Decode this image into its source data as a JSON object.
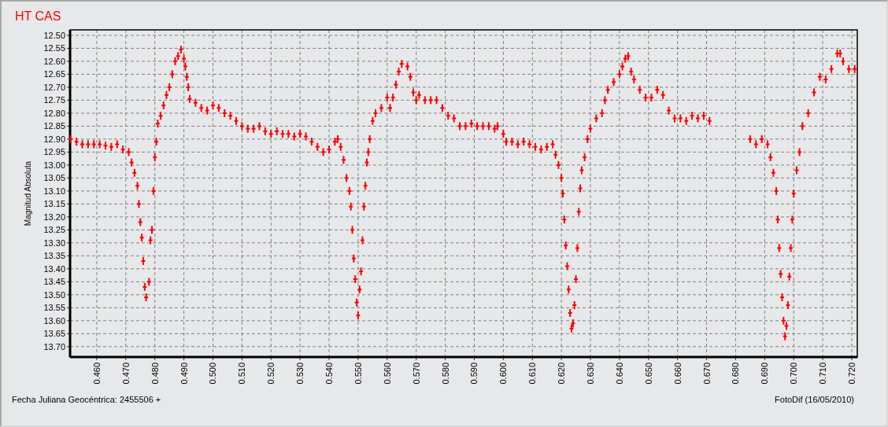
{
  "title": "HT CAS",
  "chart": {
    "chart_data": {
      "type": "scatter",
      "grid": true,
      "ylabel": "Magnitud Absoluta",
      "xlabel": "Fecha Juliana Geocéntrica: 2455506 +",
      "xlim": [
        0.4508,
        0.7219
      ],
      "ylim": [
        13.74,
        12.479
      ],
      "xticks": [
        {
          "value": 0.46,
          "label": "0.460"
        },
        {
          "value": 0.47,
          "label": "0.470"
        },
        {
          "value": 0.48,
          "label": "0.480"
        },
        {
          "value": 0.49,
          "label": "0.490"
        },
        {
          "value": 0.5,
          "label": "0.500"
        },
        {
          "value": 0.51,
          "label": "0.510"
        },
        {
          "value": 0.52,
          "label": "0.520"
        },
        {
          "value": 0.53,
          "label": "0.530"
        },
        {
          "value": 0.54,
          "label": "0.540"
        },
        {
          "value": 0.55,
          "label": "0.550"
        },
        {
          "value": 0.56,
          "label": "0.560"
        },
        {
          "value": 0.57,
          "label": "0.570"
        },
        {
          "value": 0.58,
          "label": "0.580"
        },
        {
          "value": 0.59,
          "label": "0.590"
        },
        {
          "value": 0.6,
          "label": "0.600"
        },
        {
          "value": 0.61,
          "label": "0.610"
        },
        {
          "value": 0.62,
          "label": "0.620"
        },
        {
          "value": 0.63,
          "label": "0.630"
        },
        {
          "value": 0.64,
          "label": "0.640"
        },
        {
          "value": 0.65,
          "label": "0.650"
        },
        {
          "value": 0.66,
          "label": "0.660"
        },
        {
          "value": 0.67,
          "label": "0.670"
        },
        {
          "value": 0.68,
          "label": "0.680"
        },
        {
          "value": 0.69,
          "label": "0.690"
        },
        {
          "value": 0.7,
          "label": "0.700"
        },
        {
          "value": 0.71,
          "label": "0.710"
        },
        {
          "value": 0.72,
          "label": "0.720"
        }
      ],
      "yticks": [
        {
          "value": 12.5,
          "label": "12.50"
        },
        {
          "value": 12.55,
          "label": "12.55"
        },
        {
          "value": 12.6,
          "label": "12.60"
        },
        {
          "value": 12.65,
          "label": "12.65"
        },
        {
          "value": 12.7,
          "label": "12.70"
        },
        {
          "value": 12.75,
          "label": "12.75"
        },
        {
          "value": 12.8,
          "label": "12.80"
        },
        {
          "value": 12.85,
          "label": "12.85"
        },
        {
          "value": 12.9,
          "label": "12.90"
        },
        {
          "value": 12.95,
          "label": "12.95"
        },
        {
          "value": 13.0,
          "label": "13.00"
        },
        {
          "value": 13.05,
          "label": "13.05"
        },
        {
          "value": 13.1,
          "label": "13.10"
        },
        {
          "value": 13.15,
          "label": "13.15"
        },
        {
          "value": 13.2,
          "label": "13.20"
        },
        {
          "value": 13.25,
          "label": "13.25"
        },
        {
          "value": 13.3,
          "label": "13.30"
        },
        {
          "value": 13.35,
          "label": "13.35"
        },
        {
          "value": 13.4,
          "label": "13.40"
        },
        {
          "value": 13.45,
          "label": "13.45"
        },
        {
          "value": 13.5,
          "label": "13.50"
        },
        {
          "value": 13.55,
          "label": "13.55"
        },
        {
          "value": 13.6,
          "label": "13.60"
        },
        {
          "value": 13.65,
          "label": "13.65"
        },
        {
          "value": 13.7,
          "label": "13.70"
        }
      ],
      "x": [
        0.451,
        0.453,
        0.455,
        0.457,
        0.459,
        0.461,
        0.463,
        0.465,
        0.467,
        0.469,
        0.471,
        0.472,
        0.473,
        0.474,
        0.4745,
        0.475,
        0.4755,
        0.476,
        0.4765,
        0.477,
        0.478,
        0.4785,
        0.479,
        0.4795,
        0.48,
        0.4805,
        0.481,
        0.482,
        0.483,
        0.484,
        0.485,
        0.486,
        0.487,
        0.488,
        0.489,
        0.49,
        0.4905,
        0.491,
        0.4915,
        0.492,
        0.494,
        0.496,
        0.498,
        0.5,
        0.502,
        0.504,
        0.506,
        0.508,
        0.51,
        0.512,
        0.514,
        0.516,
        0.518,
        0.52,
        0.522,
        0.524,
        0.526,
        0.528,
        0.53,
        0.532,
        0.534,
        0.536,
        0.538,
        0.54,
        0.542,
        0.543,
        0.544,
        0.545,
        0.546,
        0.547,
        0.5475,
        0.548,
        0.5485,
        0.549,
        0.5495,
        0.55,
        0.5505,
        0.551,
        0.5515,
        0.552,
        0.5525,
        0.553,
        0.5535,
        0.554,
        0.555,
        0.556,
        0.558,
        0.56,
        0.561,
        0.562,
        0.563,
        0.564,
        0.565,
        0.567,
        0.568,
        0.569,
        0.57,
        0.571,
        0.573,
        0.575,
        0.577,
        0.579,
        0.581,
        0.583,
        0.585,
        0.587,
        0.589,
        0.591,
        0.593,
        0.595,
        0.597,
        0.598,
        0.6,
        0.601,
        0.603,
        0.605,
        0.607,
        0.609,
        0.611,
        0.613,
        0.615,
        0.617,
        0.618,
        0.619,
        0.62,
        0.6205,
        0.621,
        0.6215,
        0.622,
        0.6225,
        0.623,
        0.6235,
        0.624,
        0.6245,
        0.625,
        0.6255,
        0.626,
        0.6265,
        0.627,
        0.628,
        0.629,
        0.63,
        0.632,
        0.634,
        0.635,
        0.636,
        0.638,
        0.64,
        0.641,
        0.642,
        0.643,
        0.644,
        0.645,
        0.647,
        0.649,
        0.651,
        0.653,
        0.655,
        0.657,
        0.659,
        0.661,
        0.663,
        0.665,
        0.667,
        0.669,
        0.671,
        0.685,
        0.687,
        0.689,
        0.691,
        0.692,
        0.693,
        0.694,
        0.6945,
        0.695,
        0.6955,
        0.696,
        0.6965,
        0.697,
        0.6975,
        0.698,
        0.6985,
        0.699,
        0.6995,
        0.7,
        0.701,
        0.702,
        0.703,
        0.705,
        0.707,
        0.709,
        0.711,
        0.713,
        0.715,
        0.716,
        0.717,
        0.719,
        0.721
      ],
      "series": [
        {
          "color": "#ff0000",
          "values": [
            12.9,
            12.91,
            12.92,
            12.92,
            12.92,
            12.92,
            12.925,
            12.93,
            12.92,
            12.94,
            12.95,
            12.99,
            13.03,
            13.08,
            13.15,
            13.22,
            13.28,
            13.37,
            13.47,
            13.51,
            13.45,
            13.29,
            13.25,
            13.1,
            12.97,
            12.91,
            12.84,
            12.81,
            12.77,
            12.73,
            12.7,
            12.65,
            12.6,
            12.58,
            12.555,
            12.59,
            12.62,
            12.66,
            12.7,
            12.745,
            12.76,
            12.78,
            12.79,
            12.77,
            12.78,
            12.8,
            12.81,
            12.83,
            12.85,
            12.86,
            12.86,
            12.85,
            12.87,
            12.88,
            12.87,
            12.88,
            12.88,
            12.89,
            12.88,
            12.89,
            12.91,
            12.93,
            12.95,
            12.94,
            12.91,
            12.9,
            12.93,
            12.98,
            13.05,
            13.1,
            13.16,
            13.25,
            13.36,
            13.44,
            13.53,
            13.58,
            13.48,
            13.41,
            13.29,
            13.16,
            13.08,
            12.99,
            12.95,
            12.9,
            12.83,
            12.8,
            12.78,
            12.74,
            12.78,
            12.74,
            12.69,
            12.64,
            12.61,
            12.62,
            12.66,
            12.72,
            12.75,
            12.73,
            12.75,
            12.75,
            12.75,
            12.78,
            12.81,
            12.82,
            12.85,
            12.85,
            12.84,
            12.85,
            12.85,
            12.85,
            12.86,
            12.85,
            12.88,
            12.91,
            12.91,
            12.92,
            12.91,
            12.92,
            12.93,
            12.94,
            12.93,
            12.92,
            12.96,
            13.0,
            13.05,
            13.11,
            13.21,
            13.31,
            13.39,
            13.48,
            13.57,
            13.63,
            13.61,
            13.54,
            13.44,
            13.32,
            13.18,
            13.09,
            13.02,
            12.97,
            12.9,
            12.86,
            12.82,
            12.8,
            12.75,
            12.71,
            12.68,
            12.65,
            12.62,
            12.59,
            12.58,
            12.64,
            12.67,
            12.71,
            12.74,
            12.74,
            12.71,
            12.73,
            12.79,
            12.82,
            12.82,
            12.83,
            12.81,
            12.82,
            12.81,
            12.83,
            12.9,
            12.92,
            12.9,
            12.92,
            12.97,
            13.03,
            13.1,
            13.21,
            13.32,
            13.42,
            13.51,
            13.6,
            13.66,
            13.62,
            13.54,
            13.43,
            13.32,
            13.21,
            13.11,
            13.02,
            12.95,
            12.85,
            12.8,
            12.72,
            12.66,
            12.67,
            12.63,
            12.57,
            12.57,
            12.6,
            12.63,
            12.63
          ]
        }
      ]
    }
  },
  "footer": {
    "credit": "FotoDif (16/05/2010)"
  }
}
